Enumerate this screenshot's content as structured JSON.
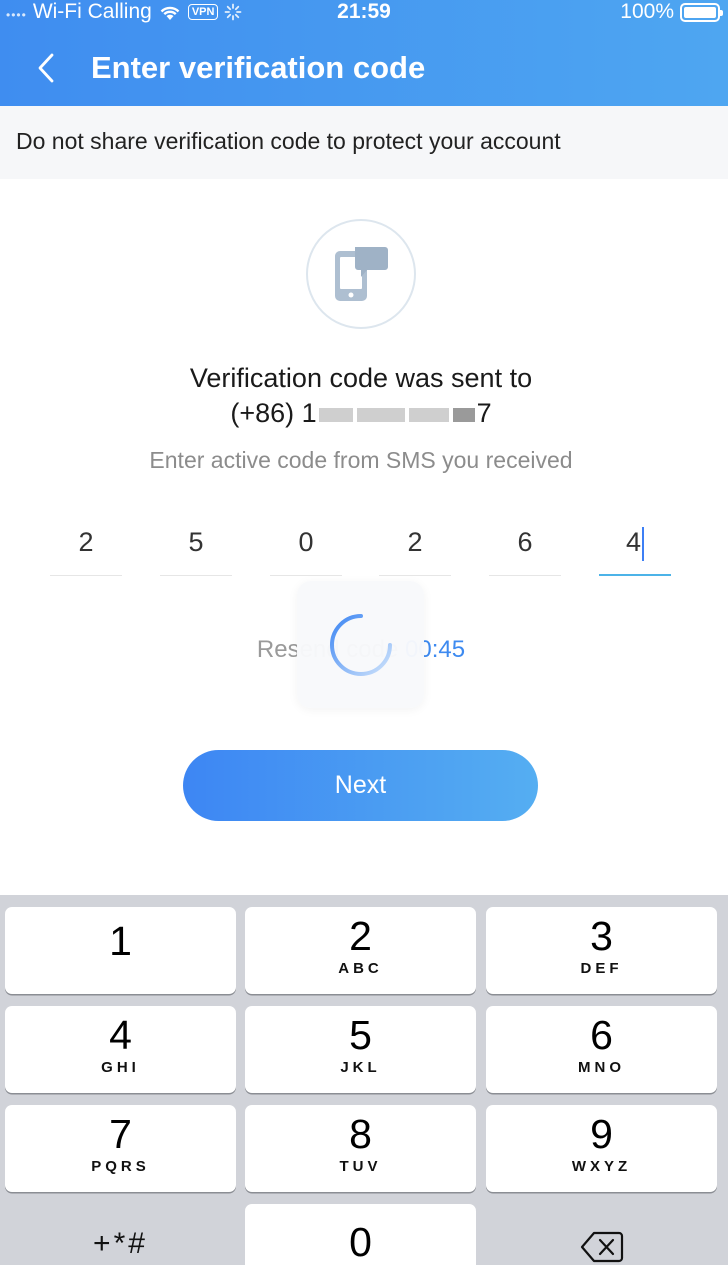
{
  "status_bar": {
    "carrier": "Wi-Fi Calling",
    "vpn": "VPN",
    "time": "21:59",
    "battery": "100%"
  },
  "header": {
    "title": "Enter verification code",
    "back_icon": "chevron-left-icon"
  },
  "notice": "Do not share verification code to protect your account",
  "main": {
    "icon": "phone-message-icon",
    "sent_title": "Verification code was sent to",
    "phone_prefix": "(+86) 1",
    "phone_suffix": "7",
    "instruction": "Enter active code from SMS you received",
    "code_digits": [
      "2",
      "5",
      "0",
      "2",
      "6",
      "4"
    ],
    "resend_label": "Resend code",
    "countdown": "00:45",
    "next_label": "Next"
  },
  "keypad": {
    "keys": [
      {
        "digit": "1",
        "letters": ""
      },
      {
        "digit": "2",
        "letters": "ABC"
      },
      {
        "digit": "3",
        "letters": "DEF"
      },
      {
        "digit": "4",
        "letters": "GHI"
      },
      {
        "digit": "5",
        "letters": "JKL"
      },
      {
        "digit": "6",
        "letters": "MNO"
      },
      {
        "digit": "7",
        "letters": "PQRS"
      },
      {
        "digit": "8",
        "letters": "TUV"
      },
      {
        "digit": "9",
        "letters": "WXYZ"
      },
      {
        "digit": "0",
        "letters": ""
      }
    ],
    "symbols_label": "+*#",
    "delete_icon": "backspace-icon"
  },
  "colors": {
    "header_start": "#3f8df0",
    "header_end": "#4ea6f1",
    "accent": "#3d8af0",
    "active_underline": "#4cb3e8"
  }
}
